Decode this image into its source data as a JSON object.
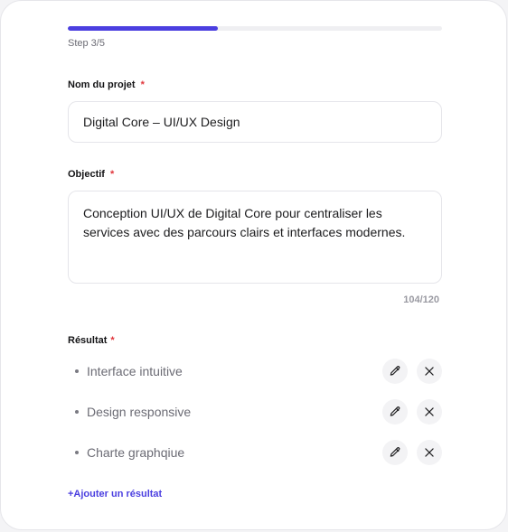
{
  "progress": {
    "step_text": "Step 3/5",
    "fraction": 0.4,
    "accent": "#4b3fe0"
  },
  "project_name": {
    "label": "Nom du projet",
    "required_mark": "*",
    "value": "Digital Core – UI/UX Design"
  },
  "objective": {
    "label": "Objectif",
    "required_mark": "*",
    "value": "Conception UI/UX de Digital Core pour centraliser les services avec des parcours clairs et interfaces modernes.",
    "counter": "104/120"
  },
  "results": {
    "label": "Résultat",
    "required_mark": "*",
    "items": [
      {
        "text": "Interface intuitive",
        "edit_icon": "pencil-icon",
        "delete_icon": "close-icon"
      },
      {
        "text": "Design responsive",
        "edit_icon": "pencil-icon",
        "delete_icon": "close-icon"
      },
      {
        "text": "Charte graphqiue",
        "edit_icon": "pencil-icon",
        "delete_icon": "close-icon"
      }
    ],
    "add_label": "+Ajouter un résultat"
  }
}
